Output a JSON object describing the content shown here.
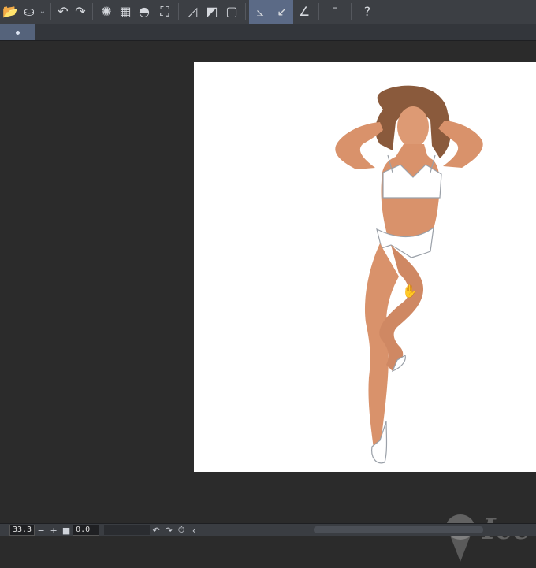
{
  "toolbar": {
    "items": [
      {
        "name": "open-folder-icon",
        "glyph": "📂",
        "active": false
      },
      {
        "name": "save-icon",
        "glyph": "⛀",
        "active": false
      },
      {
        "name": "dropdown-chevron-icon",
        "glyph": "⌄",
        "active": false
      },
      {
        "name": "undo-icon",
        "glyph": "↶",
        "active": false
      },
      {
        "name": "redo-icon",
        "glyph": "↷",
        "active": false
      },
      {
        "name": "selection-spinner-icon",
        "glyph": "✺",
        "active": false
      },
      {
        "name": "clear-selection-icon",
        "glyph": "▦",
        "active": false
      },
      {
        "name": "fill-icon",
        "glyph": "◓",
        "active": false
      },
      {
        "name": "transform-icon",
        "glyph": "⛶",
        "active": false
      },
      {
        "name": "ruler-hatch-icon",
        "glyph": "◿",
        "active": false
      },
      {
        "name": "gradient-icon",
        "glyph": "◩",
        "active": false
      },
      {
        "name": "frame-icon",
        "glyph": "▢",
        "active": false
      },
      {
        "name": "snap-ruler-icon",
        "glyph": "⦣",
        "active": true
      },
      {
        "name": "snap-curve-icon",
        "glyph": "↙",
        "active": true
      },
      {
        "name": "snap-angle-icon",
        "glyph": "∠",
        "active": false
      },
      {
        "name": "smartphone-icon",
        "glyph": "▯",
        "active": false
      },
      {
        "name": "help-icon",
        "glyph": "?",
        "active": false
      }
    ]
  },
  "tabs": {
    "active_index": 0
  },
  "watermark": {
    "text": "Ice"
  },
  "statusbar": {
    "zoom_value": "33.3",
    "minus": "−",
    "plus": "+",
    "stop": "■",
    "angle_value": "0.0",
    "rotate_left": "↶",
    "rotate_right": "↷",
    "reset": "⏱",
    "collapse": "‹"
  },
  "colors": {
    "toolbar_bg": "#3c3f44",
    "active_bg": "#5b6a86",
    "workspace_bg": "#2b2b2b",
    "canvas_bg": "#ffffff",
    "skin": "#d9926b",
    "hair": "#8a5a3c"
  }
}
